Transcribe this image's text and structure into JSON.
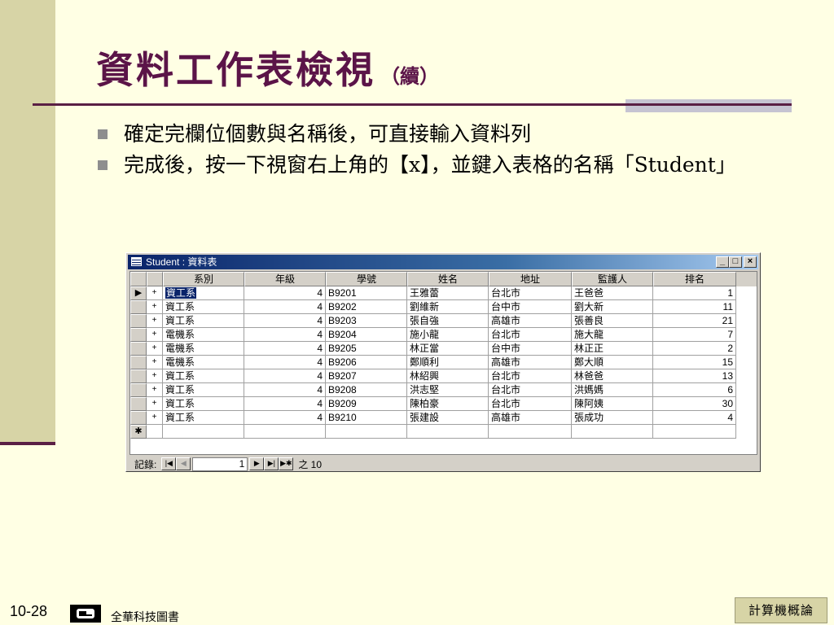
{
  "slide": {
    "title": "資料工作表檢視",
    "title_suffix": "（續）",
    "bullets": [
      "確定完欄位個數與名稱後，可直接輸入資料列",
      "完成後，按一下視窗右上角的【x】，並鍵入表格的名稱「Student」"
    ],
    "page_number": "10-28",
    "publisher": "全華科技圖書",
    "course": "計算機概論"
  },
  "window": {
    "title": "Student : 資料表",
    "buttons": {
      "minimize": "_",
      "maximize": "□",
      "close": "×"
    },
    "columns": [
      "系別",
      "年級",
      "學號",
      "姓名",
      "地址",
      "監護人",
      "排名"
    ],
    "rows": [
      {
        "dept": "資工系",
        "grade": "4",
        "id": "B9201",
        "name": "王雅蕾",
        "addr": "台北市",
        "guardian": "王爸爸",
        "rank": "1"
      },
      {
        "dept": "資工系",
        "grade": "4",
        "id": "B9202",
        "name": "劉維新",
        "addr": "台中市",
        "guardian": "劉大新",
        "rank": "11"
      },
      {
        "dept": "資工系",
        "grade": "4",
        "id": "B9203",
        "name": "張自強",
        "addr": "高雄市",
        "guardian": "張善良",
        "rank": "21"
      },
      {
        "dept": "電機系",
        "grade": "4",
        "id": "B9204",
        "name": "施小龍",
        "addr": "台北市",
        "guardian": "施大龍",
        "rank": "7"
      },
      {
        "dept": "電機系",
        "grade": "4",
        "id": "B9205",
        "name": "林正當",
        "addr": "台中市",
        "guardian": "林正正",
        "rank": "2"
      },
      {
        "dept": "電機系",
        "grade": "4",
        "id": "B9206",
        "name": "鄭順利",
        "addr": "高雄市",
        "guardian": "鄭大順",
        "rank": "15"
      },
      {
        "dept": "資工系",
        "grade": "4",
        "id": "B9207",
        "name": "林紹興",
        "addr": "台北市",
        "guardian": "林爸爸",
        "rank": "13"
      },
      {
        "dept": "資工系",
        "grade": "4",
        "id": "B9208",
        "name": "洪志堅",
        "addr": "台北市",
        "guardian": "洪媽媽",
        "rank": "6"
      },
      {
        "dept": "資工系",
        "grade": "4",
        "id": "B9209",
        "name": "陳柏豪",
        "addr": "台北市",
        "guardian": "陳阿姨",
        "rank": "30"
      },
      {
        "dept": "資工系",
        "grade": "4",
        "id": "B9210",
        "name": "張建設",
        "addr": "高雄市",
        "guardian": "張成功",
        "rank": "4"
      }
    ],
    "row_marker_current": "▶",
    "row_marker_new": "✱",
    "expand_glyph": "+",
    "record_nav": {
      "label": "記錄:",
      "current": "1",
      "of_label": "之 10",
      "first": "|◀",
      "prev": "◀",
      "next": "▶",
      "last": "▶|",
      "new": "▶✱"
    }
  }
}
